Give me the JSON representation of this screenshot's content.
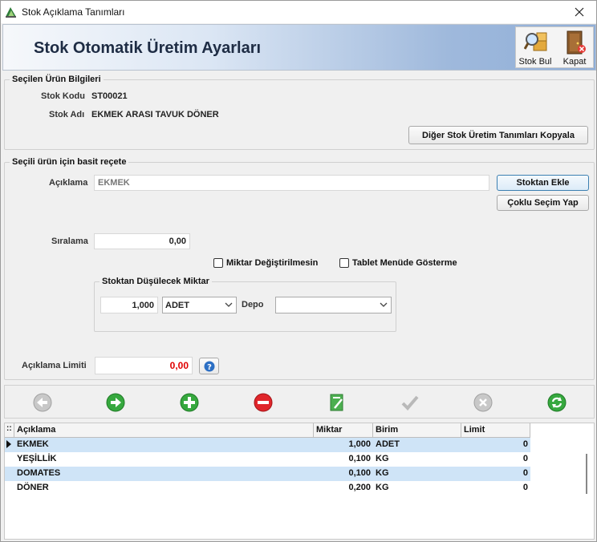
{
  "window": {
    "title": "Stok Açıklama Tanımları"
  },
  "header": {
    "title": "Stok Otomatik Üretim Ayarları",
    "tools": [
      {
        "label": "Stok Bul",
        "icon": "search-box-icon"
      },
      {
        "label": "Kapat",
        "icon": "exit-door-icon"
      }
    ]
  },
  "product_info": {
    "legend": "Seçilen Ürün Bilgileri",
    "stock_code_label": "Stok Kodu",
    "stock_code": "ST00021",
    "stock_name_label": "Stok Adı",
    "stock_name": "EKMEK ARASI TAVUK DÖNER",
    "copy_button": "Diğer Stok Üretim Tanımları Kopyala"
  },
  "recipe": {
    "legend": "Seçili ürün için basit reçete",
    "description_label": "Açıklama",
    "description_value": "EKMEK",
    "add_from_stock_button": "Stoktan Ekle",
    "multi_select_button": "Çoklu Seçim Yap",
    "order_label": "Sıralama",
    "order_value": "0,00",
    "check_qty_fixed": "Miktar Değiştirilmesin",
    "check_tablet_hide": "Tablet Menüde Gösterme",
    "deduct_legend": "Stoktan Düşülecek Miktar",
    "deduct_qty": "1,000",
    "unit_selected": "ADET",
    "depot_label": "Depo",
    "depot_selected": "",
    "limit_label": "Açıklama Limiti",
    "limit_value": "0,00",
    "limit_color": "#e00000"
  },
  "grid": {
    "columns": [
      "Açıklama",
      "Miktar",
      "Birim",
      "Limit"
    ],
    "rows": [
      {
        "desc": "EKMEK",
        "qty": "1,000",
        "unit": "ADET",
        "limit": "0",
        "selected": true
      },
      {
        "desc": "YEŞİLLİK",
        "qty": "0,100",
        "unit": "KG",
        "limit": "0"
      },
      {
        "desc": "DOMATES",
        "qty": "0,100",
        "unit": "KG",
        "limit": "0"
      },
      {
        "desc": "DÖNER",
        "qty": "0,200",
        "unit": "KG",
        "limit": "0"
      }
    ]
  },
  "colors": {
    "row_highlight": "#cfe4f7",
    "banner_accent": "#8faed8"
  }
}
